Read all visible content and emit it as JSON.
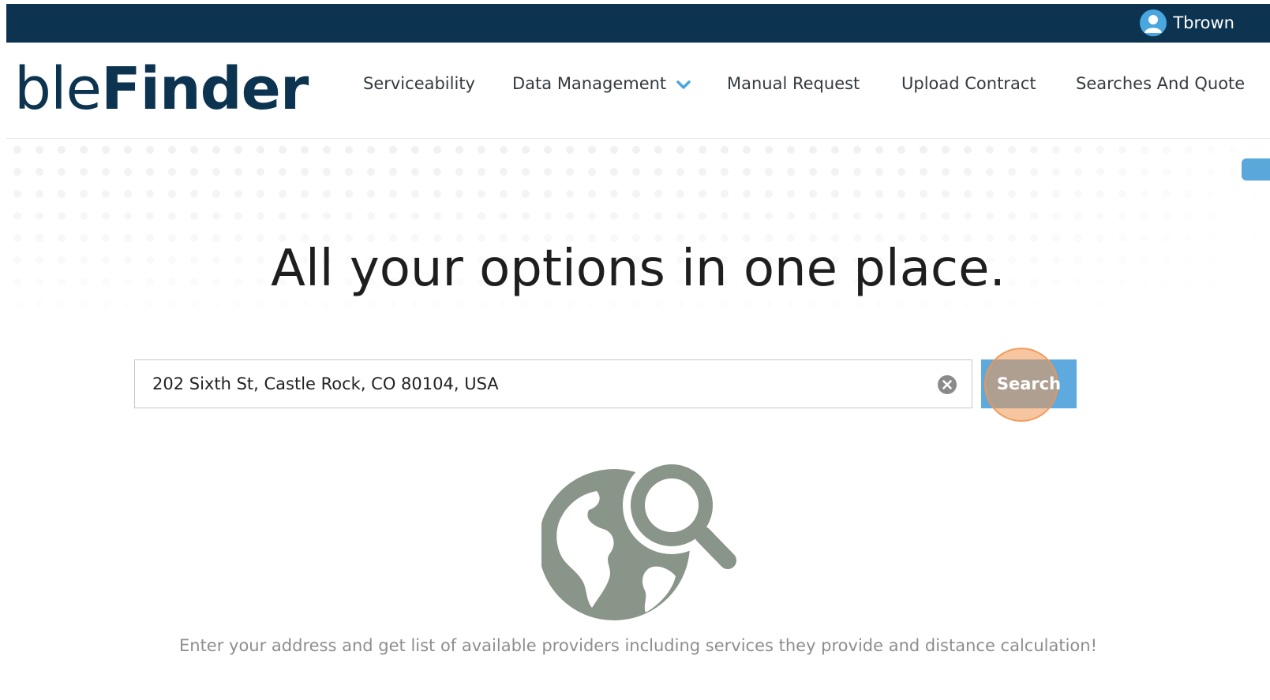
{
  "header": {
    "username": "Tbrown",
    "avatar_icon": "user-avatar-icon"
  },
  "brand": {
    "logo_light": "ble",
    "logo_bold": "Finder",
    "color": "#0c3450"
  },
  "nav": {
    "items": [
      {
        "label": "Serviceability"
      },
      {
        "label": "Data Management"
      },
      {
        "label": "Manual Request"
      },
      {
        "label": "Upload Contract"
      },
      {
        "label": "Searches And Quote"
      }
    ]
  },
  "hero": {
    "headline": "All your options in one place.",
    "tagline": "Enter your address and get list of available providers including services they provide and distance calculation!"
  },
  "search": {
    "value": "202 Sixth St, Castle Rock, CO 80104, USA",
    "button_label": "Search",
    "button_color": "#5eaadf"
  },
  "colors": {
    "topbar": "#0c3450",
    "accent": "#5eaadf",
    "illustration": "#8a958a"
  }
}
